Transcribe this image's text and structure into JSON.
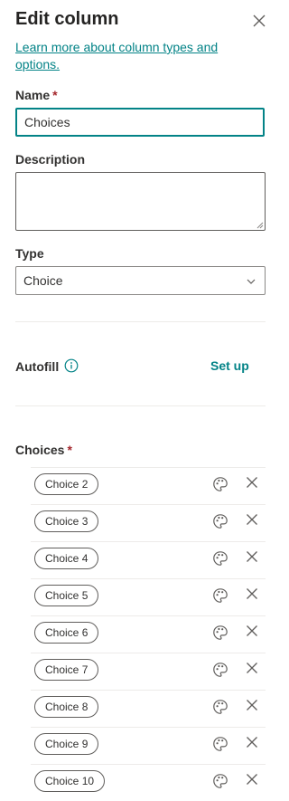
{
  "panel": {
    "title": "Edit column",
    "learn_more": "Learn more about column types and options."
  },
  "fields": {
    "name_label": "Name",
    "required_mark": "*",
    "name_value": "Choices",
    "description_label": "Description",
    "description_value": "",
    "type_label": "Type",
    "type_value": "Choice"
  },
  "autofill": {
    "label": "Autofill",
    "setup_label": "Set up"
  },
  "choices": {
    "label": "Choices",
    "items": [
      {
        "label": "Choice 2"
      },
      {
        "label": "Choice 3"
      },
      {
        "label": "Choice 4"
      },
      {
        "label": "Choice 5"
      },
      {
        "label": "Choice 6"
      },
      {
        "label": "Choice 7"
      },
      {
        "label": "Choice 8"
      },
      {
        "label": "Choice 9"
      },
      {
        "label": "Choice 10"
      }
    ]
  },
  "icons": {
    "close": "close-icon",
    "info": "info-icon",
    "chevron": "chevron-down-icon",
    "palette": "palette-icon",
    "remove": "remove-icon"
  },
  "colors": {
    "accent": "#038387",
    "required": "#a4262c",
    "text": "#323130",
    "divider": "#edebe9"
  }
}
